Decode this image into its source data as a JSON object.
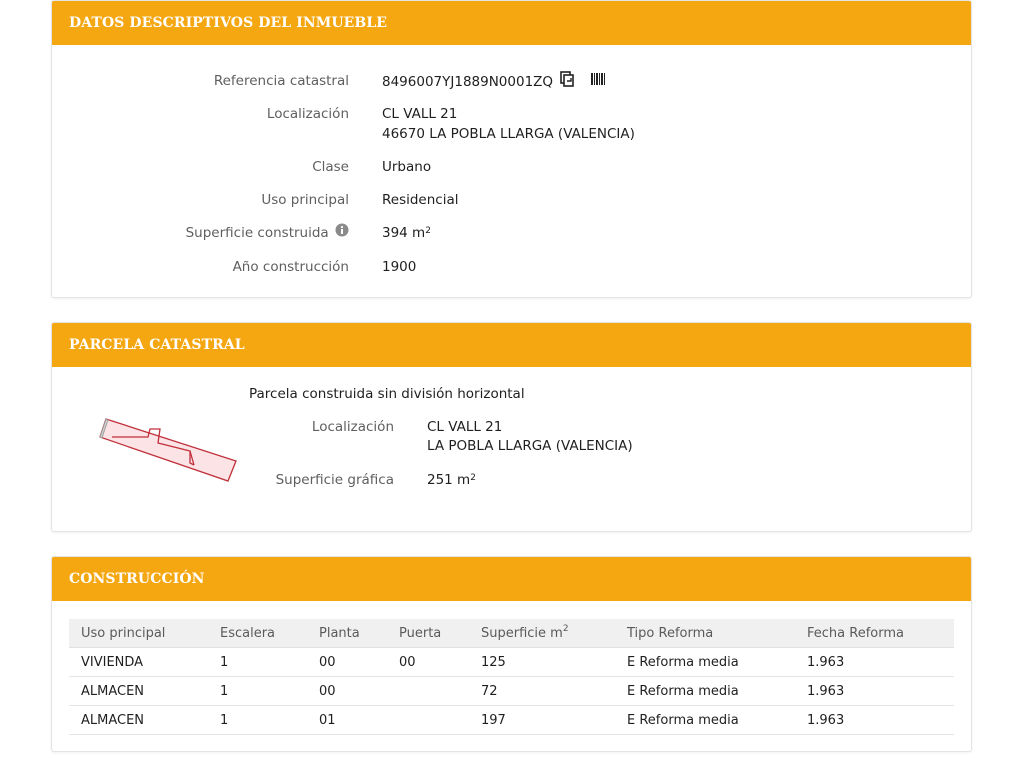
{
  "descriptivos": {
    "title": "DATOS DESCRIPTIVOS DEL INMUEBLE",
    "referencia_label": "Referencia catastral",
    "referencia_value": "8496007YJ1889N0001ZQ",
    "localizacion_label": "Localización",
    "localizacion_line1": "CL VALL 21",
    "localizacion_line2": "46670 LA POBLA LLARGA (VALENCIA)",
    "clase_label": "Clase",
    "clase_value": "Urbano",
    "uso_label": "Uso principal",
    "uso_value": "Residencial",
    "superficie_label": "Superficie construida",
    "superficie_value": "394 m",
    "superficie_unit_sup": "2",
    "anio_label": "Año construcción",
    "anio_value": "1900"
  },
  "parcela": {
    "title": "PARCELA CATASTRAL",
    "tipo": "Parcela construida sin división horizontal",
    "localizacion_label": "Localización",
    "localizacion_line1": "CL VALL 21",
    "localizacion_line2": "LA POBLA LLARGA (VALENCIA)",
    "superficie_label": "Superficie gráfica",
    "superficie_value": "251 m",
    "superficie_unit_sup": "2"
  },
  "construccion": {
    "title": "CONSTRUCCIÓN",
    "headers": [
      "Uso principal",
      "Escalera",
      "Planta",
      "Puerta",
      "Superficie m",
      "Tipo Reforma",
      "Fecha Reforma"
    ],
    "superficie_header_sup": "2",
    "rows": [
      [
        "VIVIENDA",
        "1",
        "00",
        "00",
        "125",
        "E Reforma media",
        "1.963"
      ],
      [
        "ALMACEN",
        "1",
        "00",
        "",
        "72",
        "E Reforma media",
        "1.963"
      ],
      [
        "ALMACEN",
        "1",
        "01",
        "",
        "197",
        "E Reforma media",
        "1.963"
      ]
    ]
  },
  "icons": {
    "copy": "copy-icon",
    "barcode": "barcode-icon",
    "info": "info-icon"
  },
  "colors": {
    "header": "#f5a712",
    "parcel_stroke": "#c0303a",
    "parcel_fill": "#fbe3e6"
  }
}
